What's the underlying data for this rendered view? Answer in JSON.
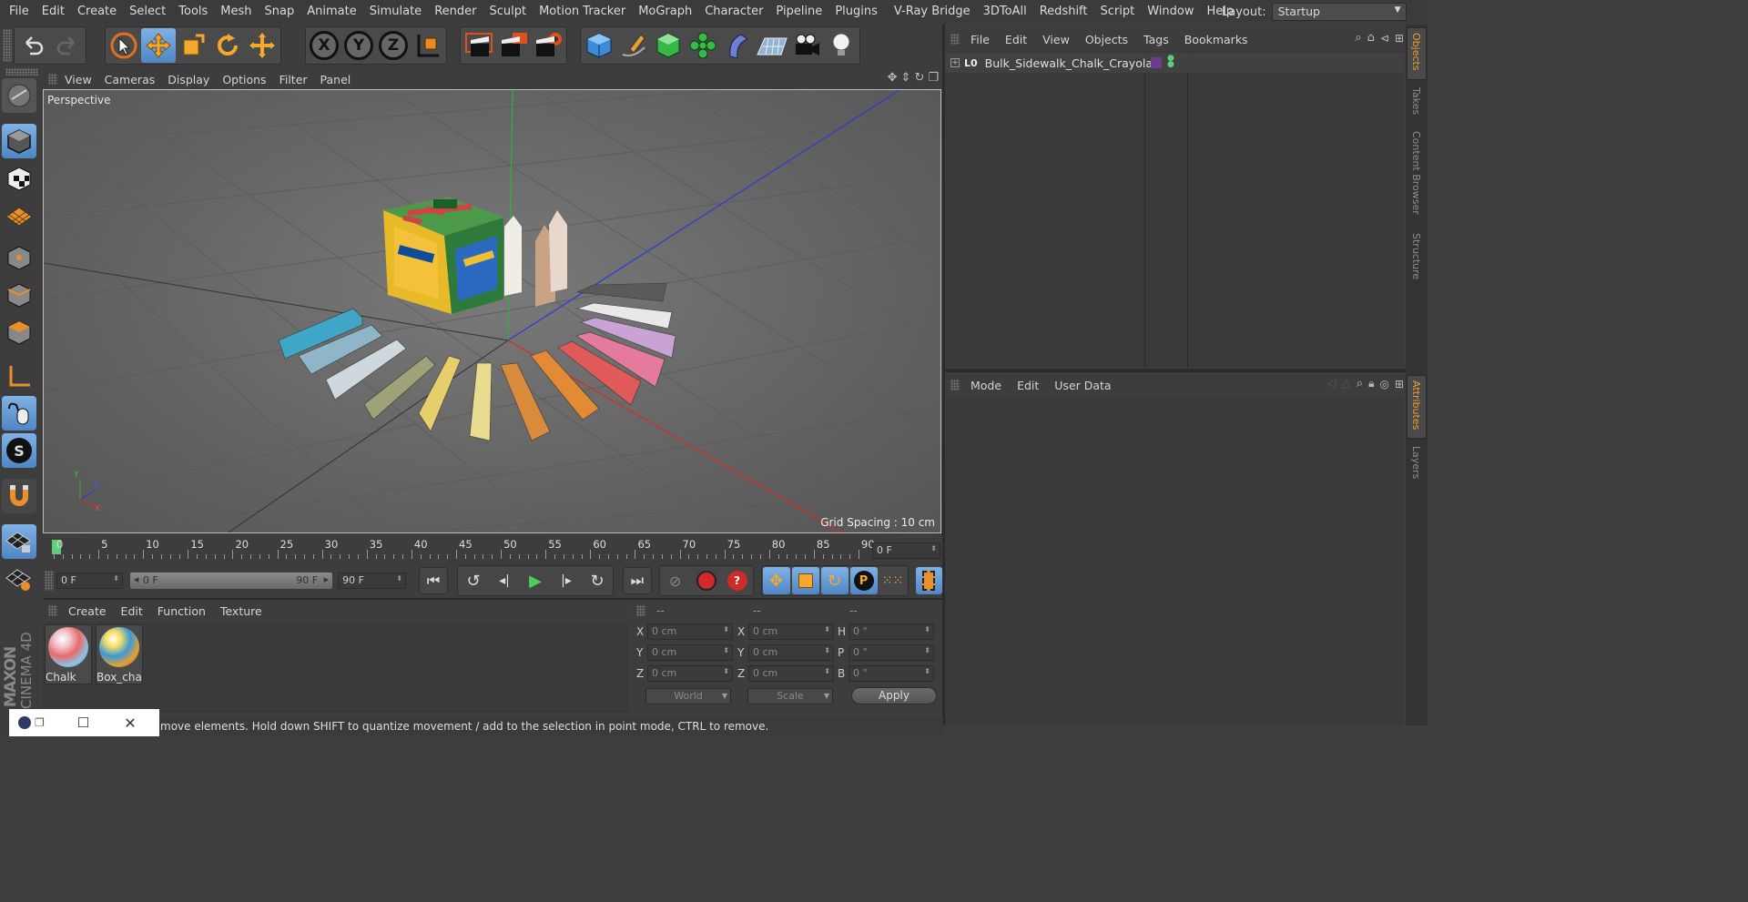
{
  "menubar": {
    "items": [
      "File",
      "Edit",
      "Create",
      "Select",
      "Tools",
      "Mesh",
      "Snap",
      "Animate",
      "Simulate",
      "Render",
      "Sculpt",
      "Motion Tracker",
      "MoGraph",
      "Character",
      "Pipeline",
      "Plugins",
      "V-Ray Bridge",
      "3DToAll",
      "Redshift",
      "Script",
      "Window",
      "Help"
    ],
    "layout_label": "Layout:",
    "layout_value": "Startup"
  },
  "toolbar": {
    "axis_x": "X",
    "axis_y": "Y",
    "axis_z": "Z"
  },
  "viewport": {
    "menu": [
      "View",
      "Cameras",
      "Display",
      "Options",
      "Filter",
      "Panel"
    ],
    "label": "Perspective",
    "grid_spacing": "Grid Spacing : 10 cm",
    "axis_labels": {
      "y": "Y",
      "z": "Z",
      "x": "X"
    }
  },
  "timeline": {
    "ticks": [
      "0",
      "5",
      "10",
      "15",
      "20",
      "25",
      "30",
      "35",
      "40",
      "45",
      "50",
      "55",
      "60",
      "65",
      "70",
      "75",
      "80",
      "85",
      "90"
    ],
    "current_frame": "0 F",
    "start_field": "0 F",
    "range_start": "0 F",
    "range_end": "90 F",
    "end_field": "90 F"
  },
  "material_manager": {
    "menu": [
      "Create",
      "Edit",
      "Function",
      "Texture"
    ],
    "materials": [
      {
        "name": "Chalk"
      },
      {
        "name": "Box_cha"
      }
    ]
  },
  "coords": {
    "headers": [
      "--",
      "--",
      "--"
    ],
    "rows": [
      {
        "a_label": "X",
        "a_value": "0 cm",
        "b_label": "X",
        "b_value": "0 cm",
        "c_label": "H",
        "c_value": "0 °"
      },
      {
        "a_label": "Y",
        "a_value": "0 cm",
        "b_label": "Y",
        "b_value": "0 cm",
        "c_label": "P",
        "c_value": "0 °"
      },
      {
        "a_label": "Z",
        "a_value": "0 cm",
        "b_label": "Z",
        "b_value": "0 cm",
        "c_label": "B",
        "c_value": "0 °"
      }
    ],
    "world": "World",
    "scale": "Scale",
    "apply": "Apply"
  },
  "object_manager": {
    "menu": [
      "File",
      "Edit",
      "View",
      "Objects",
      "Tags",
      "Bookmarks"
    ],
    "object_name": "Bulk_Sidewalk_Chalk_Crayola",
    "tag_color": "#6a3d8f"
  },
  "attribute_manager": {
    "menu": [
      "Mode",
      "Edit",
      "User Data"
    ]
  },
  "right_tabs": {
    "top": [
      "Objects",
      "Takes",
      "Content Browser",
      "Structure"
    ],
    "bottom": [
      "Attributes",
      "Layers"
    ]
  },
  "brand": {
    "maxon": "MAXON",
    "product": "CINEMA 4D"
  },
  "statusbar": {
    "text": "move elements. Hold down SHIFT to quantize movement / add to the selection in point mode, CTRL to remove."
  },
  "colors": {
    "accent_blue": "#5b92d0",
    "orange": "#f0a030",
    "timeline_marker": "#5ad07a"
  }
}
